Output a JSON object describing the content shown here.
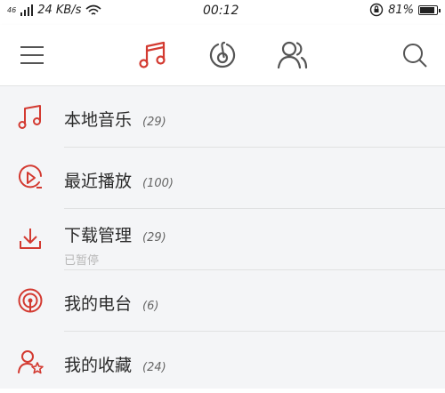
{
  "status_bar": {
    "network": "46",
    "speed": "24 KB/s",
    "time": "00:12",
    "battery": "81%",
    "battery_level": 0.81,
    "icons": [
      "signal-icon",
      "wifi-icon",
      "orientation-lock-icon",
      "battery-icon"
    ]
  },
  "nav": {
    "icons": [
      "menu-icon",
      "music-icon",
      "discover-icon",
      "friends-icon",
      "search-icon"
    ],
    "active_color": "#d33a31",
    "inactive_color": "#555555"
  },
  "accent_color": "#d33a31",
  "items": [
    {
      "label": "本地音乐",
      "count": "(29)",
      "icon": "music-note-icon"
    },
    {
      "label": "最近播放",
      "count": "(100)",
      "icon": "recent-play-icon"
    },
    {
      "label": "下载管理",
      "count": "(29)",
      "sub": "已暂停",
      "icon": "download-icon"
    },
    {
      "label": "我的电台",
      "count": "(6)",
      "icon": "radio-icon"
    },
    {
      "label": "我的收藏",
      "count": "(24)",
      "icon": "favorites-icon"
    }
  ]
}
